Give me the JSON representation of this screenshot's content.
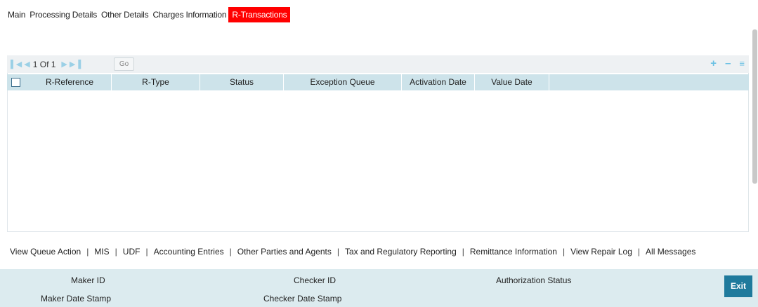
{
  "tabs": [
    {
      "label": "Main",
      "active": false
    },
    {
      "label": "Processing Details",
      "active": false
    },
    {
      "label": "Other Details",
      "active": false
    },
    {
      "label": "Charges Information",
      "active": false
    },
    {
      "label": "R-Transactions",
      "active": true
    }
  ],
  "grid": {
    "pagination": {
      "text": "1 Of 1",
      "go_label": "Go"
    },
    "columns": [
      "R-Reference",
      "R-Type",
      "Status",
      "Exception Queue",
      "Activation Date",
      "Value Date"
    ],
    "rows": []
  },
  "footer_links": [
    "View Queue Action",
    "MIS",
    "UDF",
    "Accounting Entries",
    "Other Parties and Agents",
    "Tax and Regulatory Reporting",
    "Remittance Information",
    "View Repair Log",
    "All Messages"
  ],
  "audit": {
    "maker_id": "Maker ID",
    "maker_date_stamp": "Maker Date Stamp",
    "checker_id": "Checker ID",
    "checker_date_stamp": "Checker Date Stamp",
    "authorization_status": "Authorization Status"
  },
  "exit_label": "Exit",
  "colors": {
    "active_tab": "#ff0000",
    "header_bg": "#cde3ea",
    "audit_bg": "#dcebef",
    "exit_btn": "#1f7a9c",
    "toolbar_icon": "#69c0e3"
  }
}
